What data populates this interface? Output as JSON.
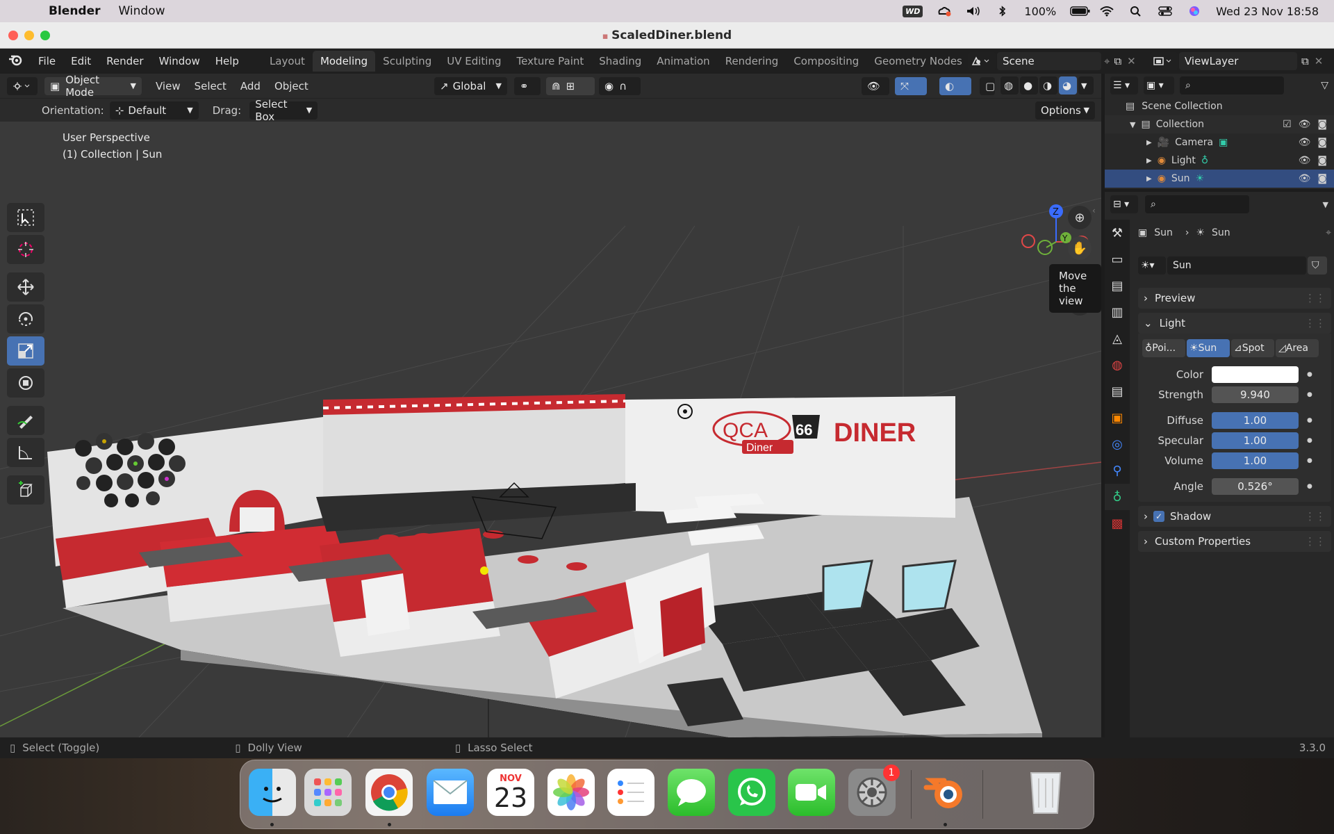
{
  "macbar": {
    "app_name": "Blender",
    "menu": [
      "Window"
    ],
    "wd_badge": "WD",
    "battery": "100%",
    "datetime": "Wed 23 Nov  18:58"
  },
  "window": {
    "title": "ScaledDiner.blend"
  },
  "topbar": {
    "menus": [
      "File",
      "Edit",
      "Render",
      "Window",
      "Help"
    ],
    "workspaces": [
      "Layout",
      "Modeling",
      "Sculpting",
      "UV Editing",
      "Texture Paint",
      "Shading",
      "Animation",
      "Rendering",
      "Compositing",
      "Geometry Nodes"
    ],
    "active_workspace": "Modeling",
    "scene": "Scene",
    "view_layer": "ViewLayer"
  },
  "viewport": {
    "mode": "Object Mode",
    "menus": [
      "View",
      "Select",
      "Add",
      "Object"
    ],
    "transform_orientation": "Global",
    "orientation_label": "Orientation:",
    "orientation_value": "Default",
    "drag_label": "Drag:",
    "drag_value": "Select Box",
    "options": "Options",
    "info_line1": "User Perspective",
    "info_line2": "(1) Collection | Sun",
    "tooltip": "Move the view",
    "scene_texts": {
      "qca": "QCA",
      "diner_small": "Diner",
      "diner_big": "DINER",
      "route": "66"
    },
    "gizmo_labels": {
      "z": "Z",
      "y": "Y",
      "x": "X"
    }
  },
  "outliner": {
    "root": "Scene Collection",
    "collection": "Collection",
    "items": [
      "Camera",
      "Light",
      "Sun"
    ]
  },
  "properties": {
    "breadcrumb": [
      "Sun",
      "Sun"
    ],
    "datablock": "Sun",
    "panels": {
      "preview": "Preview",
      "light": "Light",
      "shadow": "Shadow",
      "custom": "Custom Properties"
    },
    "light_types": [
      "Poi...",
      "Sun",
      "Spot",
      "Area"
    ],
    "active_light_type": "Sun",
    "fields": [
      {
        "label": "Color",
        "value": ""
      },
      {
        "label": "Strength",
        "value": "9.940"
      },
      {
        "label": "Diffuse",
        "value": "1.00"
      },
      {
        "label": "Specular",
        "value": "1.00"
      },
      {
        "label": "Volume",
        "value": "1.00"
      },
      {
        "label": "Angle",
        "value": "0.526°"
      }
    ],
    "shadow_checked": true
  },
  "statusbar": {
    "left": "Select (Toggle)",
    "middle": "Dolly View",
    "right": "Lasso Select",
    "version": "3.3.0"
  },
  "dock": {
    "calendar_month": "NOV",
    "calendar_day": "23",
    "settings_badge": "1"
  },
  "colors": {
    "accent_blue": "#4772b3",
    "diner_red": "#c62a30",
    "viewport_bg": "#3a3a3a"
  }
}
